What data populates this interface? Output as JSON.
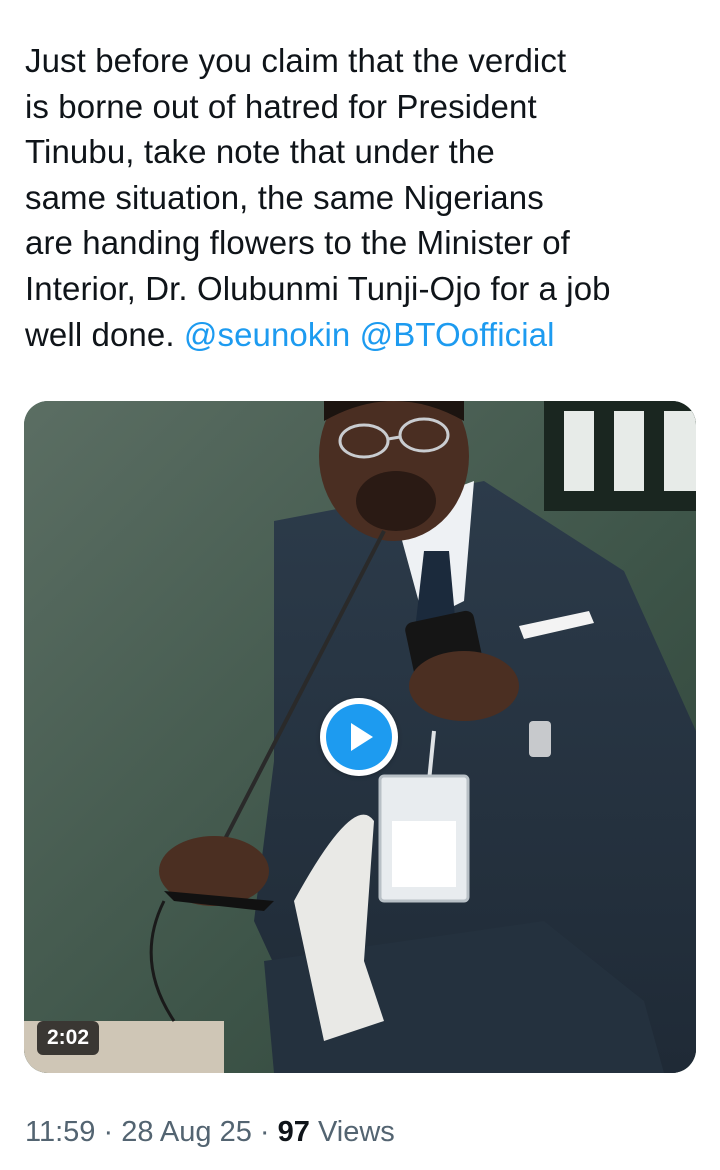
{
  "tweet": {
    "text_lines": [
      "Just before you claim that the verdict",
      "is borne out of hatred for President",
      "Tinubu, take note that under the",
      "same situation, the same Nigerians",
      "are handing flowers to the Minister of",
      "Interior, Dr. Olubunmi Tunji-Ojo for a job",
      "well done. "
    ],
    "mentions": [
      "@seunokin",
      "@BTOofficial"
    ]
  },
  "media": {
    "type": "video",
    "duration": "2:02",
    "play_icon": "play-icon"
  },
  "meta": {
    "time": "11:59",
    "separator": " · ",
    "date": "28 Aug 25",
    "views_count": "97",
    "views_label": " Views"
  },
  "colors": {
    "text": "#0f1419",
    "secondary": "#536471",
    "accent": "#1d9bf0"
  }
}
